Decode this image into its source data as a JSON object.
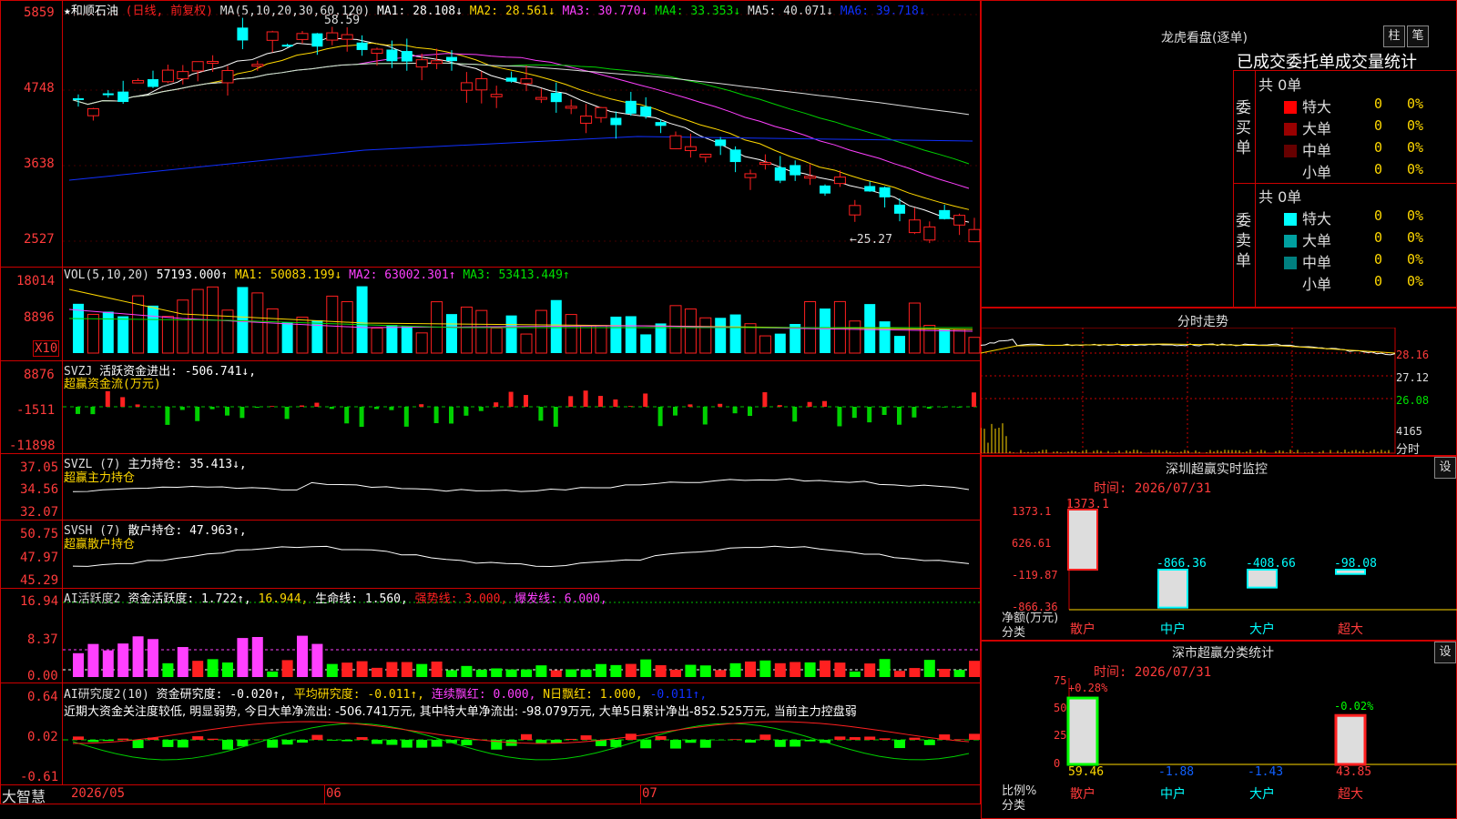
{
  "stock": {
    "title": "★和顺石油",
    "mode": "(日线, 前复权)"
  },
  "ma_line": {
    "params": "MA(5,10,20,30,60,120)",
    "ma1": "MA1: 28.108↓",
    "ma2": "MA2: 28.561↓",
    "ma3": "MA3: 30.770↓",
    "ma4": "MA4: 33.353↓",
    "ma5": "MA5: 40.071↓",
    "ma6": "MA6: 39.718↓"
  },
  "price_axis": {
    "labels": [
      "5859",
      "4748",
      "3638",
      "2527"
    ],
    "high_note": "58.59",
    "low_note": "←25.27"
  },
  "vol": {
    "caption": "VOL(5,10,20)",
    "value": "57193.000↑",
    "ma1": "MA1: 50083.199↓",
    "ma2": "MA2: 63002.301↑",
    "ma3": "MA3: 53413.449↑",
    "axis": [
      "18014",
      "8896"
    ],
    "unit": "X10"
  },
  "svzj": {
    "caption": "SVZJ",
    "label": "活跃资金进出: -506.741↓,",
    "sub": "超赢资金流(万元)",
    "axis": [
      "8876",
      "-1511",
      "-11898"
    ]
  },
  "svzl": {
    "caption": "SVZL (7)",
    "label": "主力持仓: 35.413↓,",
    "sub": "超赢主力持仓",
    "axis": [
      "37.05",
      "34.56",
      "32.07"
    ]
  },
  "svsh": {
    "caption": "SVSH (7)",
    "label": "散户持仓: 47.963↑,",
    "sub": "超赢散户持仓",
    "axis": [
      "50.75",
      "47.97",
      "45.29"
    ]
  },
  "ai_active": {
    "caption": "AI活跃度2",
    "v1": "资金活跃度: 1.722↑,",
    "v2": "16.944,",
    "v3": "生命线: 1.560,",
    "v4": "强势线: 3.000,",
    "v5": "爆发线: 6.000,",
    "axis": [
      "16.94",
      "8.37",
      "0.00"
    ]
  },
  "ai_research": {
    "caption": "AI研究度2(10)",
    "v1": "资金研究度: -0.020↑,",
    "v2": "平均研究度: -0.011↑,",
    "v3": "连续飘红: 0.000,",
    "v4": "N日飘红: 1.000,",
    "v5": "-0.011↑,",
    "comment": "近期大资金关注度较低, 明显弱势, 今日大单净流出: -506.741万元, 其中特大单净流出: -98.079万元, 大单5日累计净出-852.525万元, 当前主力控盘弱",
    "axis": [
      "0.64",
      "0.02",
      "-0.61"
    ]
  },
  "time_axis": {
    "brand": "大智慧",
    "labels": [
      "2026/05",
      "06",
      "07"
    ]
  },
  "lhb": {
    "title": "龙虎看盘(逐单)",
    "btn1": "柱",
    "btn2": "笔",
    "tabs": "已成交委托单成交量统计",
    "buy_label": "委买单",
    "sell_label": "委卖单",
    "buy_total": "共 0单",
    "sell_total": "共 0单",
    "buy_rows": [
      {
        "name": "特大",
        "qty": "0",
        "pct": "0%",
        "color": "#ff0000"
      },
      {
        "name": "大单",
        "qty": "0",
        "pct": "0%",
        "color": "#990000"
      },
      {
        "name": "中单",
        "qty": "0",
        "pct": "0%",
        "color": "#660000"
      },
      {
        "name": "小单",
        "qty": "0",
        "pct": "0%",
        "color": "#000000"
      }
    ],
    "sell_rows": [
      {
        "name": "特大",
        "qty": "0",
        "pct": "0%",
        "color": "#00ffff"
      },
      {
        "name": "大单",
        "qty": "0",
        "pct": "0%",
        "color": "#00a0a0"
      },
      {
        "name": "中单",
        "qty": "0",
        "pct": "0%",
        "color": "#008080"
      },
      {
        "name": "小单",
        "qty": "0",
        "pct": "0%",
        "color": "#000000"
      }
    ]
  },
  "fenshi": {
    "title": "分时走势",
    "axis": [
      "28.16",
      "27.12",
      "26.08",
      "4165",
      "分时"
    ]
  },
  "sz_monitor": {
    "title": "深圳超赢实时监控",
    "btn": "设",
    "time": "时间: 2026/07/31",
    "axis": [
      "1373.1",
      "626.61",
      "-119.87",
      "-866.36"
    ],
    "unit1": "净额(万元)",
    "unit2": "分类",
    "bars": [
      {
        "cat": "散户",
        "value": 1373.1,
        "label": "1373.1"
      },
      {
        "cat": "中户",
        "value": -866.36,
        "label": "-866.36"
      },
      {
        "cat": "大户",
        "value": -408.66,
        "label": "-408.66"
      },
      {
        "cat": "超大",
        "value": -98.08,
        "label": "-98.08"
      }
    ]
  },
  "sz_class": {
    "title": "深市超赢分类统计",
    "btn": "设",
    "time": "时间: 2026/07/31",
    "axis": [
      "75",
      "50",
      "25",
      "0"
    ],
    "unit1": "比例%",
    "unit2": "分类",
    "top_labels": [
      "+0.28%",
      "-0.02%"
    ],
    "bars": [
      {
        "cat": "散户",
        "value": 59.46,
        "label": "59.46"
      },
      {
        "cat": "中户",
        "value": -1.88,
        "label": "-1.88"
      },
      {
        "cat": "大户",
        "value": -1.43,
        "label": "-1.43"
      },
      {
        "cat": "超大",
        "value": 43.85,
        "label": "43.85"
      }
    ]
  },
  "colors": {
    "up": "#ff2020",
    "down": "#00ffff",
    "grid": "#c00000",
    "yellow": "#ffd800",
    "magenta": "#ff40ff",
    "green": "#00d000",
    "blue": "#1030ff"
  }
}
